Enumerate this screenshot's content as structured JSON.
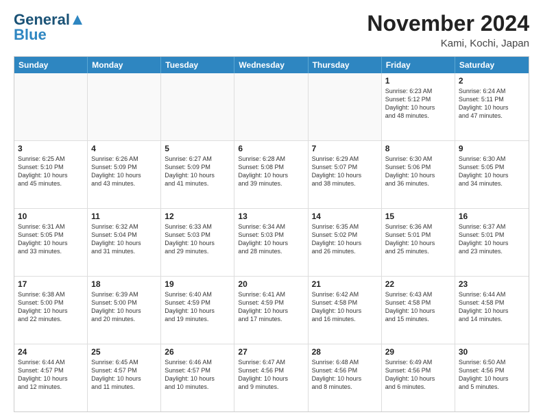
{
  "header": {
    "logo_line1": "General",
    "logo_line2": "Blue",
    "title": "November 2024",
    "subtitle": "Kami, Kochi, Japan"
  },
  "days_of_week": [
    "Sunday",
    "Monday",
    "Tuesday",
    "Wednesday",
    "Thursday",
    "Friday",
    "Saturday"
  ],
  "weeks": [
    [
      {
        "day": "",
        "info": ""
      },
      {
        "day": "",
        "info": ""
      },
      {
        "day": "",
        "info": ""
      },
      {
        "day": "",
        "info": ""
      },
      {
        "day": "",
        "info": ""
      },
      {
        "day": "1",
        "info": "Sunrise: 6:23 AM\nSunset: 5:12 PM\nDaylight: 10 hours\nand 48 minutes."
      },
      {
        "day": "2",
        "info": "Sunrise: 6:24 AM\nSunset: 5:11 PM\nDaylight: 10 hours\nand 47 minutes."
      }
    ],
    [
      {
        "day": "3",
        "info": "Sunrise: 6:25 AM\nSunset: 5:10 PM\nDaylight: 10 hours\nand 45 minutes."
      },
      {
        "day": "4",
        "info": "Sunrise: 6:26 AM\nSunset: 5:09 PM\nDaylight: 10 hours\nand 43 minutes."
      },
      {
        "day": "5",
        "info": "Sunrise: 6:27 AM\nSunset: 5:09 PM\nDaylight: 10 hours\nand 41 minutes."
      },
      {
        "day": "6",
        "info": "Sunrise: 6:28 AM\nSunset: 5:08 PM\nDaylight: 10 hours\nand 39 minutes."
      },
      {
        "day": "7",
        "info": "Sunrise: 6:29 AM\nSunset: 5:07 PM\nDaylight: 10 hours\nand 38 minutes."
      },
      {
        "day": "8",
        "info": "Sunrise: 6:30 AM\nSunset: 5:06 PM\nDaylight: 10 hours\nand 36 minutes."
      },
      {
        "day": "9",
        "info": "Sunrise: 6:30 AM\nSunset: 5:05 PM\nDaylight: 10 hours\nand 34 minutes."
      }
    ],
    [
      {
        "day": "10",
        "info": "Sunrise: 6:31 AM\nSunset: 5:05 PM\nDaylight: 10 hours\nand 33 minutes."
      },
      {
        "day": "11",
        "info": "Sunrise: 6:32 AM\nSunset: 5:04 PM\nDaylight: 10 hours\nand 31 minutes."
      },
      {
        "day": "12",
        "info": "Sunrise: 6:33 AM\nSunset: 5:03 PM\nDaylight: 10 hours\nand 29 minutes."
      },
      {
        "day": "13",
        "info": "Sunrise: 6:34 AM\nSunset: 5:03 PM\nDaylight: 10 hours\nand 28 minutes."
      },
      {
        "day": "14",
        "info": "Sunrise: 6:35 AM\nSunset: 5:02 PM\nDaylight: 10 hours\nand 26 minutes."
      },
      {
        "day": "15",
        "info": "Sunrise: 6:36 AM\nSunset: 5:01 PM\nDaylight: 10 hours\nand 25 minutes."
      },
      {
        "day": "16",
        "info": "Sunrise: 6:37 AM\nSunset: 5:01 PM\nDaylight: 10 hours\nand 23 minutes."
      }
    ],
    [
      {
        "day": "17",
        "info": "Sunrise: 6:38 AM\nSunset: 5:00 PM\nDaylight: 10 hours\nand 22 minutes."
      },
      {
        "day": "18",
        "info": "Sunrise: 6:39 AM\nSunset: 5:00 PM\nDaylight: 10 hours\nand 20 minutes."
      },
      {
        "day": "19",
        "info": "Sunrise: 6:40 AM\nSunset: 4:59 PM\nDaylight: 10 hours\nand 19 minutes."
      },
      {
        "day": "20",
        "info": "Sunrise: 6:41 AM\nSunset: 4:59 PM\nDaylight: 10 hours\nand 17 minutes."
      },
      {
        "day": "21",
        "info": "Sunrise: 6:42 AM\nSunset: 4:58 PM\nDaylight: 10 hours\nand 16 minutes."
      },
      {
        "day": "22",
        "info": "Sunrise: 6:43 AM\nSunset: 4:58 PM\nDaylight: 10 hours\nand 15 minutes."
      },
      {
        "day": "23",
        "info": "Sunrise: 6:44 AM\nSunset: 4:58 PM\nDaylight: 10 hours\nand 14 minutes."
      }
    ],
    [
      {
        "day": "24",
        "info": "Sunrise: 6:44 AM\nSunset: 4:57 PM\nDaylight: 10 hours\nand 12 minutes."
      },
      {
        "day": "25",
        "info": "Sunrise: 6:45 AM\nSunset: 4:57 PM\nDaylight: 10 hours\nand 11 minutes."
      },
      {
        "day": "26",
        "info": "Sunrise: 6:46 AM\nSunset: 4:57 PM\nDaylight: 10 hours\nand 10 minutes."
      },
      {
        "day": "27",
        "info": "Sunrise: 6:47 AM\nSunset: 4:56 PM\nDaylight: 10 hours\nand 9 minutes."
      },
      {
        "day": "28",
        "info": "Sunrise: 6:48 AM\nSunset: 4:56 PM\nDaylight: 10 hours\nand 8 minutes."
      },
      {
        "day": "29",
        "info": "Sunrise: 6:49 AM\nSunset: 4:56 PM\nDaylight: 10 hours\nand 6 minutes."
      },
      {
        "day": "30",
        "info": "Sunrise: 6:50 AM\nSunset: 4:56 PM\nDaylight: 10 hours\nand 5 minutes."
      }
    ]
  ]
}
